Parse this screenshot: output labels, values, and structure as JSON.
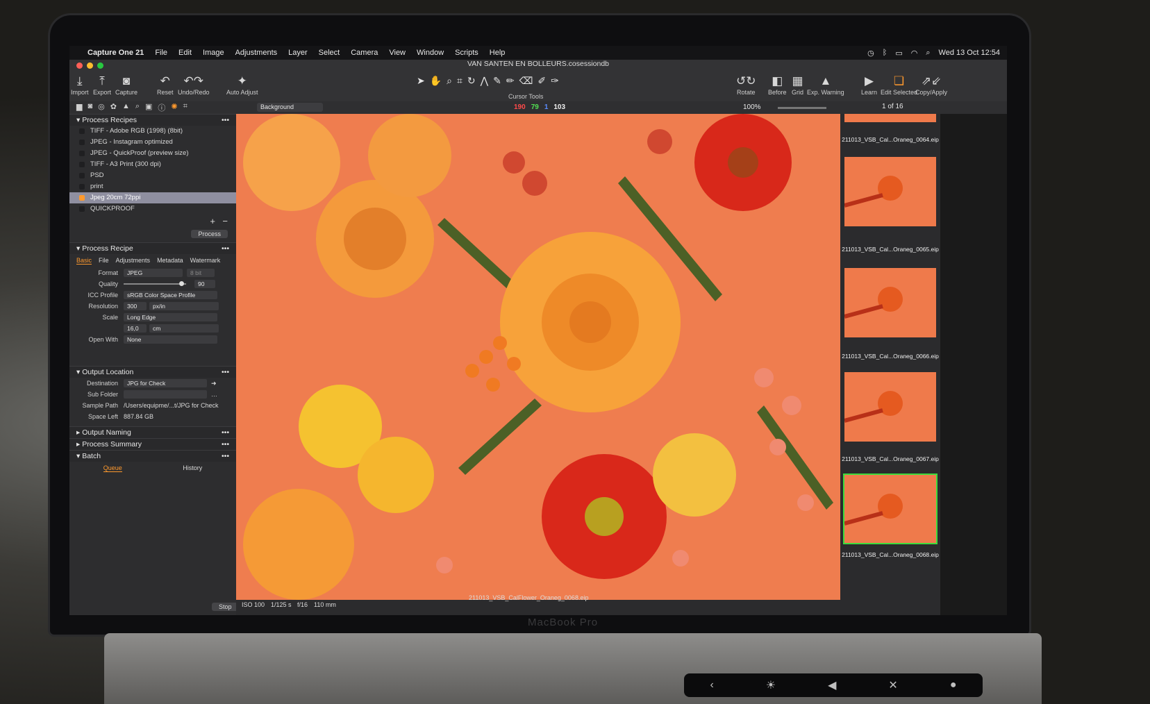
{
  "menubar": {
    "app": "Capture One 21",
    "items": [
      "File",
      "Edit",
      "Image",
      "Adjustments",
      "Layer",
      "Select",
      "Camera",
      "View",
      "Window",
      "Scripts",
      "Help"
    ],
    "clock": "Wed 13 Oct  12:54"
  },
  "window": {
    "title": "VAN SANTEN EN BOLLEURS.cosessiondb"
  },
  "toolbar": {
    "import": "Import",
    "export": "Export",
    "capture": "Capture",
    "reset": "Reset",
    "undo_redo": "Undo/Redo",
    "auto_adjust": "Auto Adjust",
    "cursor_tools": "Cursor Tools",
    "rotate": "Rotate",
    "before": "Before",
    "grid": "Grid",
    "exp_warning": "Exp. Warning",
    "learn": "Learn",
    "edit_selected": "Edit Selected",
    "copy_apply": "Copy/Apply"
  },
  "viewerbar": {
    "background_select": "Background",
    "rgb_r": "190",
    "rgb_g": "79",
    "rgb_b": "1",
    "rgb_l": "103",
    "zoom": "100%",
    "counter": "1 of 16"
  },
  "process_recipes": {
    "title": "Process Recipes",
    "items": [
      "TIFF - Adobe RGB (1998) (8bit)",
      "JPEG - Instagram optimized",
      "JPEG - QuickProof (preview size)",
      "TIFF - A3 Print (300 dpi)",
      "PSD",
      "print",
      "Jpeg 20cm 72ppi",
      "QUICKPROOF"
    ],
    "selected_index": 6,
    "process_button": "Process"
  },
  "process_recipe": {
    "title": "Process Recipe",
    "tabs": [
      "Basic",
      "File",
      "Adjustments",
      "Metadata",
      "Watermark"
    ],
    "format_label": "Format",
    "format_value": "JPEG",
    "bit_value": "8 bit",
    "quality_label": "Quality",
    "quality_value": "90",
    "icc_label": "ICC Profile",
    "icc_value": "sRGB Color Space Profile",
    "resolution_label": "Resolution",
    "resolution_value": "300",
    "resolution_unit": "px/in",
    "scale_label": "Scale",
    "scale_value": "Long Edge",
    "scale_amount": "16,0",
    "scale_unit": "cm",
    "open_with_label": "Open With",
    "open_with_value": "None"
  },
  "output_location": {
    "title": "Output Location",
    "destination_label": "Destination",
    "destination_value": "JPG for Check",
    "sub_folder_label": "Sub Folder",
    "sample_path_label": "Sample Path",
    "sample_path_value": "/Users/equipme/...t/JPG for Check",
    "space_left_label": "Space Left",
    "space_left_value": "887.84 GB"
  },
  "collapsed_sections": [
    "Output Naming",
    "Process Summary"
  ],
  "batch": {
    "title": "Batch",
    "queue": "Queue",
    "history": "History",
    "stop": "Stop"
  },
  "status": {
    "iso": "ISO 100",
    "shutter": "1/125 s",
    "aperture": "f/16",
    "focal": "110 mm",
    "filename": "211013_VSB_CalFlower_Oraneg_0068.eip"
  },
  "thumbnails": [
    "211013_VSB_Cal...Oraneg_0064.eip",
    "211013_VSB_Cal...Oraneg_0065.eip",
    "211013_VSB_Cal...Oraneg_0066.eip",
    "211013_VSB_Cal...Oraneg_0067.eip",
    "211013_VSB_Cal...Oraneg_0068.eip"
  ],
  "device": {
    "brand": "MacBook Pro"
  },
  "colors": {
    "accent": "#ff9a2e",
    "selection": "#3cdc3c",
    "background": "#ef7d4f"
  }
}
